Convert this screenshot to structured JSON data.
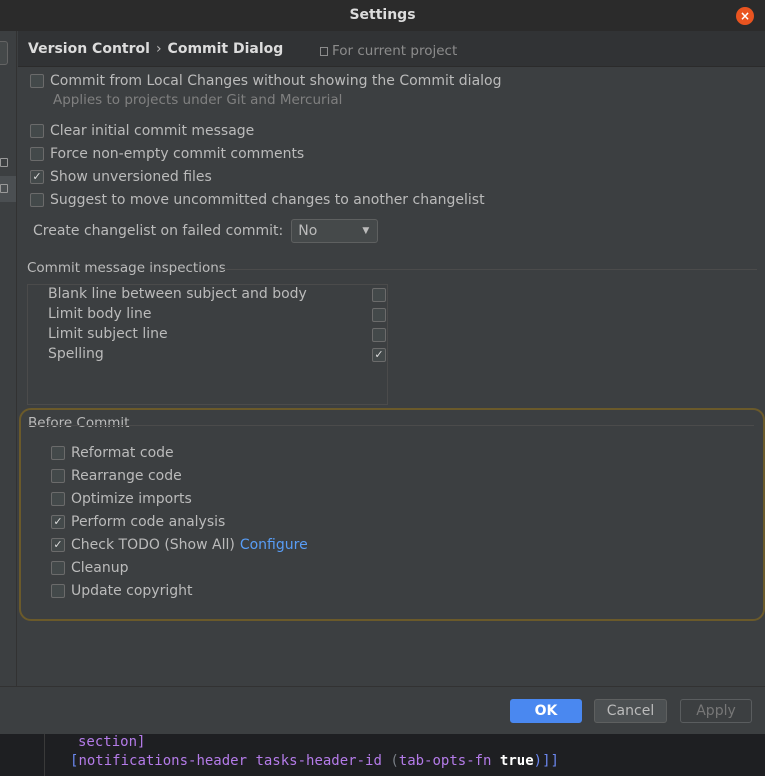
{
  "window": {
    "title": "Settings",
    "close_label": "×"
  },
  "breadcrumb": {
    "parent": "Version Control",
    "separator": "›",
    "current": "Commit Dialog",
    "scope": "For current project"
  },
  "commit_options": {
    "local_changes": {
      "label": "Commit from Local Changes without showing the Commit dialog",
      "hint": "Applies to projects under Git and Mercurial",
      "checked": false
    },
    "clear_initial": {
      "label": "Clear initial commit message",
      "checked": false
    },
    "force_non_empty": {
      "label": "Force non-empty commit comments",
      "checked": false
    },
    "show_unversioned": {
      "label": "Show unversioned files",
      "checked": true
    },
    "suggest_move": {
      "label": "Suggest to move uncommitted changes to another changelist",
      "checked": false
    }
  },
  "changelist": {
    "label": "Create changelist on failed commit:",
    "value": "No",
    "arrow": "▼"
  },
  "inspections": {
    "title": "Commit message inspections",
    "items": [
      {
        "label": "Blank line between subject and body",
        "checked": false
      },
      {
        "label": "Limit body line",
        "checked": false
      },
      {
        "label": "Limit subject line",
        "checked": false
      },
      {
        "label": "Spelling",
        "checked": true
      }
    ]
  },
  "before_commit": {
    "title": "Before Commit",
    "items": [
      {
        "label": "Reformat code",
        "checked": false
      },
      {
        "label": "Rearrange code",
        "checked": false
      },
      {
        "label": "Optimize imports",
        "checked": false
      },
      {
        "label": "Perform code analysis",
        "checked": true
      },
      {
        "label": "Check TODO (Show All)",
        "checked": true,
        "link": "Configure"
      },
      {
        "label": "Cleanup",
        "checked": false
      },
      {
        "label": "Update copyright",
        "checked": false
      }
    ]
  },
  "footer": {
    "ok": "OK",
    "cancel": "Cancel",
    "apply": "Apply"
  },
  "editor": {
    "line1": "section]",
    "line2": {
      "open": "[",
      "sym1": "notifications-header",
      "sym2": "tasks-header-id",
      "paren_open": "(",
      "fn": "tab-opts-fn",
      "bool": "true",
      "close": ")]]"
    }
  },
  "colors": {
    "accent": "#4a88f0",
    "link": "#589df6",
    "highlight_border": "#6b5a2a",
    "close": "#e95420"
  }
}
